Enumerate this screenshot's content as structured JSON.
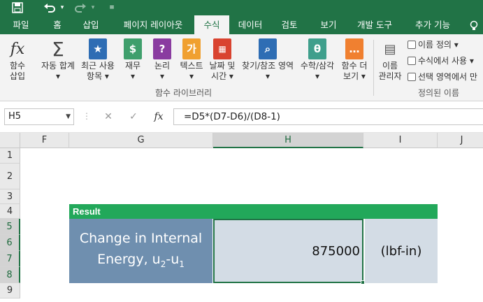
{
  "qat": {
    "save_icon": "save-icon",
    "undo_icon": "undo-icon",
    "redo_icon": "redo-icon",
    "customize_icon": "customize-icon"
  },
  "tabs": [
    "파일",
    "홈",
    "삽입",
    "페이지 레이아웃",
    "수식",
    "데이터",
    "검토",
    "보기",
    "개발 도구",
    "추가 기능"
  ],
  "active_tab": "수식",
  "ribbon": {
    "insert_function": {
      "line1": "함수",
      "line2": "삽입"
    },
    "autosum": {
      "line1": "자동 합계",
      "line2": "▾"
    },
    "recent": {
      "line1": "최근 사용",
      "line2": "항목 ▾"
    },
    "financial": {
      "line1": "재무",
      "line2": "▾"
    },
    "logical": {
      "line1": "논리",
      "line2": "▾"
    },
    "text": {
      "line1": "텍스트",
      "line2": "▾"
    },
    "datetime": {
      "line1": "날짜 및",
      "line2": "시간 ▾"
    },
    "lookup": {
      "line1": "찾기/참조 영역",
      "line2": "▾"
    },
    "math": {
      "line1": "수학/삼각",
      "line2": "▾"
    },
    "more": {
      "line1": "함수 더",
      "line2": "보기 ▾"
    },
    "library_group": "함수 라이브러리",
    "name_manager": {
      "line1": "이름",
      "line2": "관리자"
    },
    "define_name": "이름 정의 ▾",
    "use_in_formula": "수식에서 사용 ▾",
    "create_from_selection": "선택 영역에서 만",
    "names_group": "정의된 이름",
    "help_icon": "lightbulb-icon"
  },
  "formula_bar": {
    "name_box": "H5",
    "cancel": "✕",
    "enter": "✓",
    "fx": "fx",
    "formula": "=D5*(D7-D6)/(D8-1)"
  },
  "columns": [
    "F",
    "G",
    "H",
    "I",
    "J"
  ],
  "selected_column": "H",
  "rows": [
    "1",
    "2",
    "3",
    "4",
    "5",
    "6",
    "7",
    "8",
    "9"
  ],
  "cells": {
    "result_header": "Result",
    "g_line1": "Change in Internal",
    "g_line2_prefix": "Energy, u",
    "g_sub1": "2",
    "g_mid": "-u",
    "g_sub2": "1",
    "h_value": "875000",
    "i_unit": "(lbf-in)"
  },
  "colors": {
    "accent": "#217346",
    "result_bar": "#22a85a",
    "label_fill": "#6f8faf",
    "value_fill": "#d3dce5"
  }
}
